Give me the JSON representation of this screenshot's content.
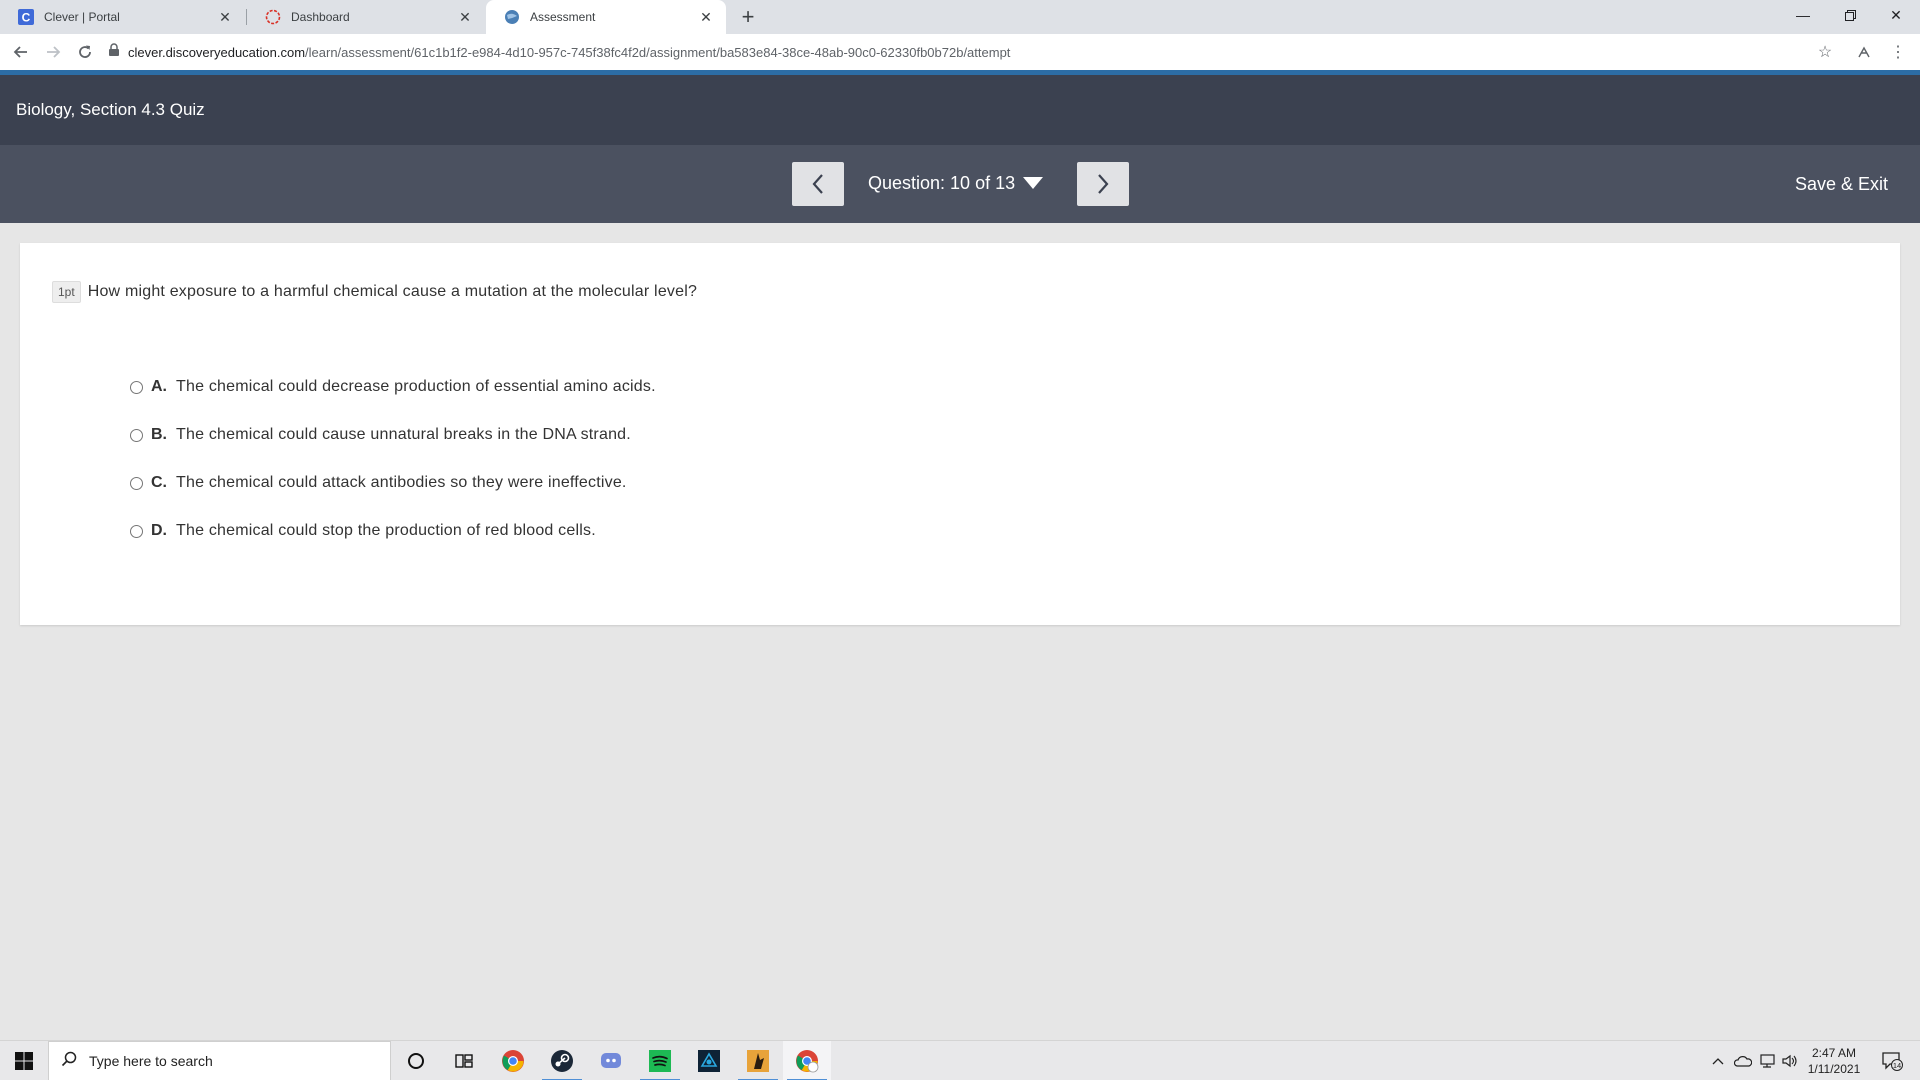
{
  "browser": {
    "tabs": [
      {
        "title": "Clever | Portal",
        "icon": "clever-icon",
        "active": false
      },
      {
        "title": "Dashboard",
        "icon": "dashboard-icon",
        "active": false
      },
      {
        "title": "Assessment",
        "icon": "discovery-globe-icon",
        "active": true
      }
    ],
    "url_host": "clever.discoveryeducation.com",
    "url_path": "/learn/assessment/61c1b1f2-e984-4d10-957c-745f38fc4f2d/assignment/ba583e84-38ce-48ab-90c0-62330fb0b72b/attempt"
  },
  "app": {
    "title": "Biology, Section 4.3 Quiz",
    "question_counter": "Question: 10 of 13",
    "save_exit_label": "Save & Exit",
    "accent_color": "#2c6da6",
    "header_color": "#3b4150"
  },
  "question": {
    "points": "1pt",
    "text": "How might exposure to a harmful chemical cause a mutation at the molecular level?",
    "choices": [
      {
        "letter": "A.",
        "text": "The chemical could decrease production of essential amino acids."
      },
      {
        "letter": "B.",
        "text": "The chemical could cause unnatural breaks in the DNA strand."
      },
      {
        "letter": "C.",
        "text": "The chemical could attack antibodies so they were ineffective."
      },
      {
        "letter": "D.",
        "text": "The chemical could stop the production of red blood cells."
      }
    ]
  },
  "taskbar": {
    "search_placeholder": "Type here to search",
    "time": "2:47 AM",
    "date": "1/11/2021",
    "notification_count": "14",
    "apps": [
      "cortana-icon",
      "task-view-icon",
      "chrome-icon",
      "steam-icon",
      "discord-icon",
      "spotify-icon",
      "game-app-icon",
      "game-app-icon-2",
      "chrome-active-icon"
    ]
  }
}
